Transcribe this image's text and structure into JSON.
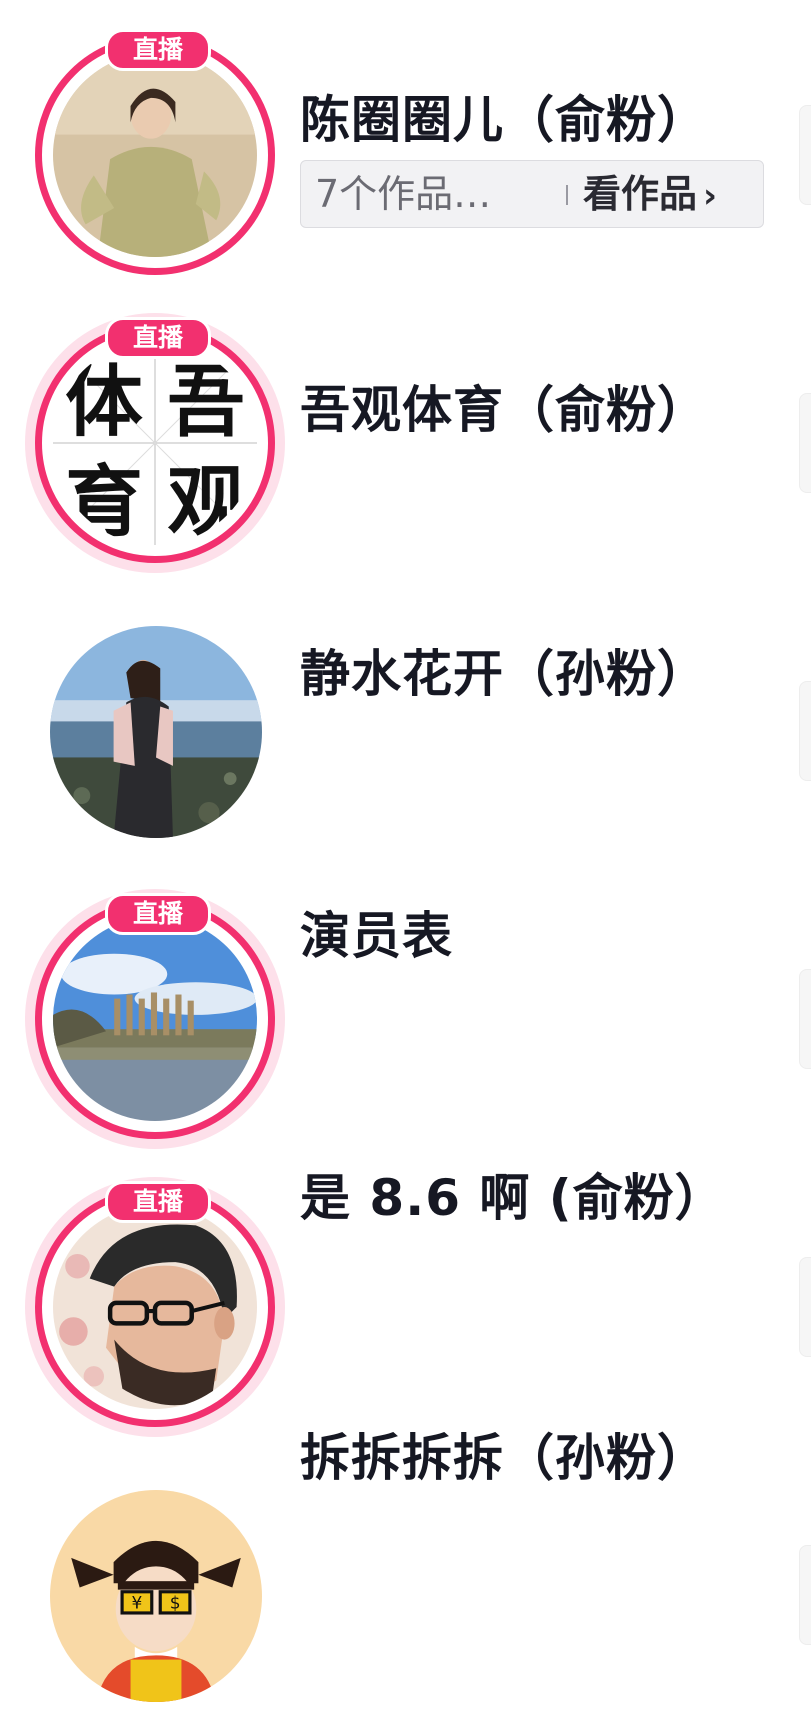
{
  "live_badge": "直播",
  "rows": [
    {
      "name": "陈圈圈儿（俞粉）",
      "live": true,
      "works_count": "7个作品…",
      "works_link": "看作品",
      "avatar": "avatar-woman-green-dress"
    },
    {
      "name": "吾观体育（俞粉）",
      "live": true,
      "avatar": "avatar-logo-calligraphy",
      "logo_chars": [
        "体",
        "吾",
        "育",
        "观"
      ]
    },
    {
      "name": "静水花开（孙粉）",
      "live": false,
      "avatar": "avatar-woman-seaside"
    },
    {
      "name": "演员表",
      "live": true,
      "avatar": "avatar-lake-landscape"
    },
    {
      "name": "是 8.6 啊 (俞粉）",
      "live": true,
      "avatar": "avatar-bearded-man-glasses"
    },
    {
      "name": "拆拆拆拆（孙粉）",
      "live": false,
      "avatar": "avatar-cartoon-girl",
      "glasses_symbols": [
        "¥",
        "$"
      ]
    }
  ],
  "icons": {
    "chevron": "›"
  },
  "colors": {
    "live_ring": "#f2306f",
    "name_text": "#161823",
    "halo": "#fde0ea"
  }
}
